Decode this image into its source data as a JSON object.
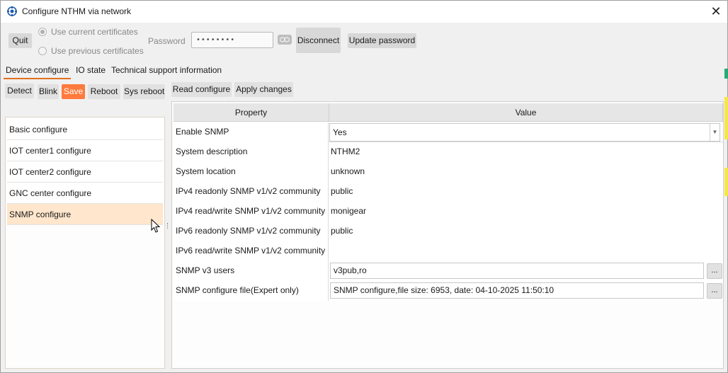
{
  "window": {
    "title": "Configure NTHM via network",
    "close_symbol": "✕"
  },
  "toolbar": {
    "quit_label": "Quit",
    "use_current_label": "Use current certificates",
    "use_previous_label": "Use previous certificates",
    "password_label": "Password",
    "password_value": "••••••••",
    "disconnect_label": "Disconnect",
    "update_password_label": "Update password"
  },
  "tabs": [
    {
      "label": "Device configure"
    },
    {
      "label": "IO state"
    },
    {
      "label": "Technical support information"
    }
  ],
  "device_buttons": {
    "detect": "Detect",
    "blink": "Blink",
    "save": "Save",
    "reboot": "Reboot",
    "sys_reboot": "Sys reboot"
  },
  "config_buttons": {
    "read": "Read configure",
    "apply": "Apply changes"
  },
  "sections": [
    {
      "label": "Basic configure"
    },
    {
      "label": "IOT center1 configure"
    },
    {
      "label": "IOT center2 configure"
    },
    {
      "label": "GNC center configure"
    },
    {
      "label": "SNMP configure"
    }
  ],
  "table": {
    "headers": {
      "property": "Property",
      "value": "Value"
    },
    "rows": [
      {
        "property": "Enable SNMP",
        "value": "Yes"
      },
      {
        "property": "System description",
        "value": "NTHM2"
      },
      {
        "property": "System location",
        "value": "unknown"
      },
      {
        "property": "IPv4 readonly SNMP v1/v2 community",
        "value": "public"
      },
      {
        "property": "IPv4 read/write SNMP v1/v2 community",
        "value": "monigear"
      },
      {
        "property": "IPv6 readonly SNMP v1/v2 community",
        "value": "public"
      },
      {
        "property": "IPv6 read/write SNMP v1/v2 community",
        "value": ""
      },
      {
        "property": "SNMP v3 users",
        "value": "v3pub,ro"
      },
      {
        "property": "SNMP configure file(Expert only)",
        "value": "SNMP configure,file size: 6953, date: 04-10-2025 11:50:10"
      }
    ],
    "ellipsis_label": "..."
  },
  "colors": {
    "accent": "#ff7a3d",
    "selected_row": "#ffe6cc",
    "tab_underline": "#e07020"
  }
}
